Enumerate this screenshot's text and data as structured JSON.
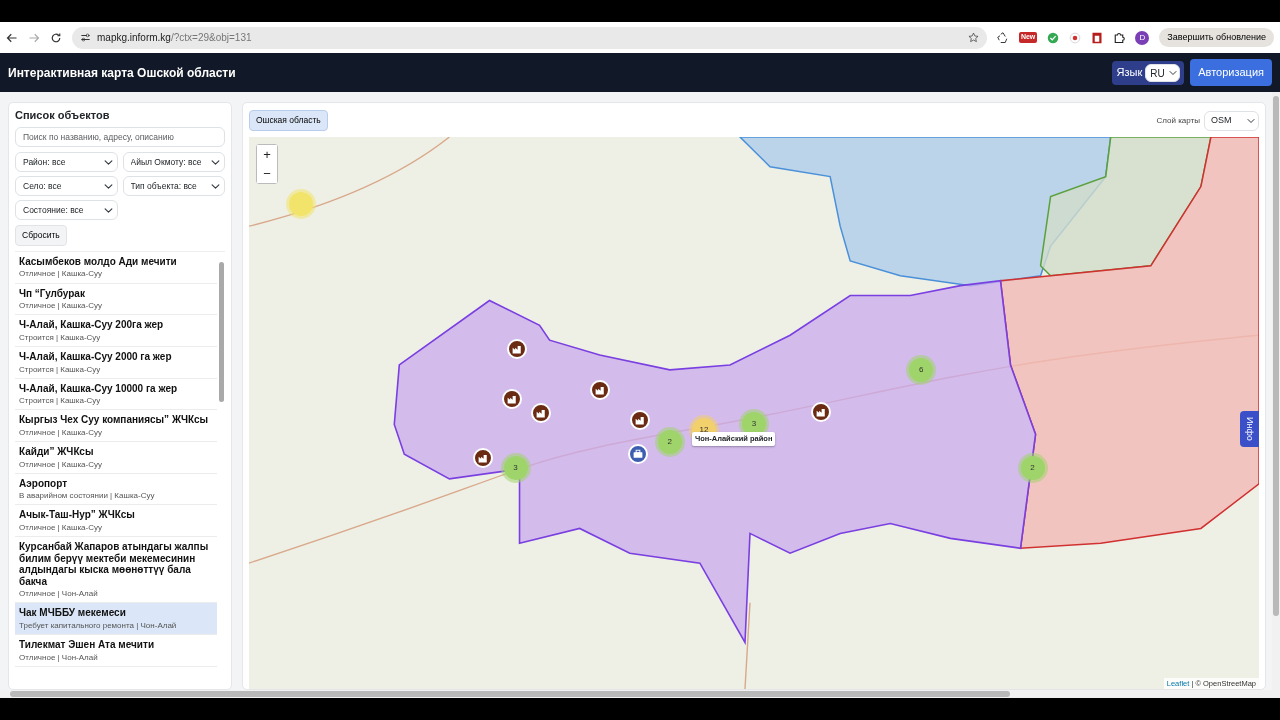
{
  "browser": {
    "url_host": "mapkg.inform.kg",
    "url_path": "/?ctx=29&obj=131",
    "extension_badge": "New",
    "profile": "D",
    "update_button": "Завершить обновление"
  },
  "navbar": {
    "title": "Интерактивная карта Ошской области",
    "language_label": "Язык",
    "language_value": "RU",
    "login_button": "Авторизация"
  },
  "sidebar": {
    "title": "Список объектов",
    "search": {
      "placeholder": "Поиск по названию, адресу, описанию"
    },
    "filters": [
      "Район: все",
      "Айыл Окмоту: все",
      "Село: все",
      "Тип объекта: все",
      "Состояние: все"
    ],
    "reset_button": "Сбросить",
    "items": [
      {
        "name": "Касымбеков молдо Ади мечити",
        "subtitle": "Отличное | Кашка-Суу",
        "selected": false
      },
      {
        "name": "Чп “Гулбурак",
        "subtitle": "Отличное | Кашка-Суу",
        "selected": false
      },
      {
        "name": "Ч-Алай, Кашка-Суу 200га жер",
        "subtitle": "Строится | Кашка-Суу",
        "selected": false
      },
      {
        "name": "Ч-Алай, Кашка-Суу 2000 га жер",
        "subtitle": "Строится | Кашка-Суу",
        "selected": false
      },
      {
        "name": "Ч-Алай, Кашка-Суу 10000 га жер",
        "subtitle": "Строится | Кашка-Суу",
        "selected": false
      },
      {
        "name": "Кыргыз Чех Суу компаниясы” ЖЧКсы",
        "subtitle": "Отличное | Кашка-Суу",
        "selected": false
      },
      {
        "name": "Кайди” ЖЧКсы",
        "subtitle": "Отличное | Кашка-Суу",
        "selected": false
      },
      {
        "name": "Аэропорт",
        "subtitle": "В аварийном состоянии | Кашка-Суу",
        "selected": false
      },
      {
        "name": "Ачык-Таш-Нур” ЖЧКсы",
        "subtitle": "Отличное | Кашка-Суу",
        "selected": false
      },
      {
        "name": "Курсанбай Жапаров атындагы жалпы билим берүү мектеби мекемесинин алдындагы кыска мөөнөттүү бала бакча",
        "subtitle": "Отличное | Чон-Алай",
        "selected": false
      },
      {
        "name": "Чак МЧББУ мекемеси",
        "subtitle": "Требует капитального ремонта | Чон-Алай",
        "selected": true
      },
      {
        "name": "Тилекмат Эшен Ата мечити",
        "subtitle": "Отличное | Чон-Алай",
        "selected": false
      }
    ]
  },
  "map": {
    "region_button": "Ошская область",
    "layer_label": "Слой карты",
    "layer_value": "OSM",
    "zoom_in": "+",
    "zoom_out": "−",
    "markers": [
      {
        "kind": "facility"
      },
      {
        "kind": "facility"
      },
      {
        "kind": "facility"
      },
      {
        "kind": "facility"
      },
      {
        "kind": "facility"
      },
      {
        "kind": "facility"
      },
      {
        "kind": "facility"
      },
      {
        "kind": "hospital"
      },
      {
        "kind": "cluster",
        "count": "12",
        "color": "#f2d06b"
      },
      {
        "kind": "cluster",
        "count": "3",
        "color": "#9fd46a"
      },
      {
        "kind": "cluster",
        "count": "2",
        "color": "#9fd46a"
      },
      {
        "kind": "cluster",
        "count": "3",
        "color": "#9fd46a"
      },
      {
        "kind": "cluster",
        "count": "6",
        "color": "#9fd46a"
      },
      {
        "kind": "cluster",
        "count": "2",
        "color": "#9fd46a"
      },
      {
        "kind": "cluster",
        "color": "#f2e36b"
      }
    ],
    "tooltip": "Чон-Алайский район",
    "info_tab": "Инфо",
    "attribution_link": "Leaflet",
    "attribution_text": "| © OpenStreetMap"
  }
}
